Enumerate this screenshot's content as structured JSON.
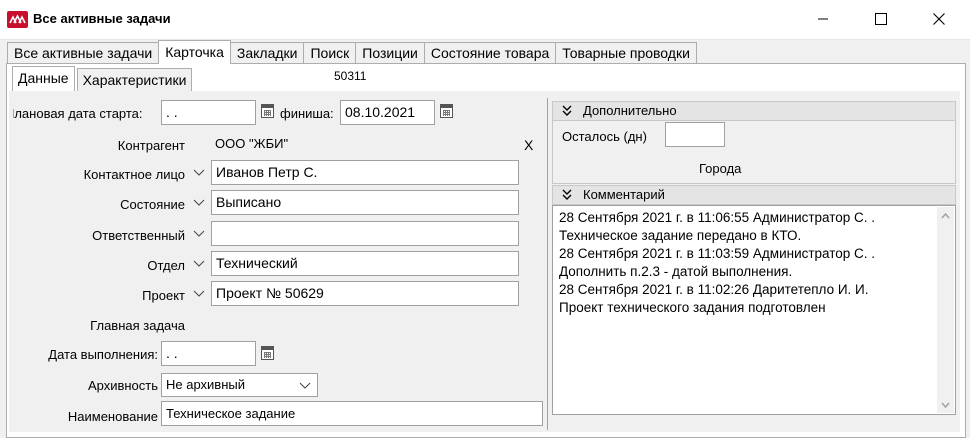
{
  "window": {
    "title": "Все активные задачи",
    "logo_icon": "app-logo-icon",
    "controls": [
      "minimize-icon",
      "maximize-icon",
      "close-icon"
    ]
  },
  "tabs": [
    {
      "label": "Все активные задачи",
      "active": false
    },
    {
      "label": "Карточка",
      "active": true
    },
    {
      "label": "Закладки",
      "active": false
    },
    {
      "label": "Поиск",
      "active": false
    },
    {
      "label": "Позиции",
      "active": false
    },
    {
      "label": "Состояние товара",
      "active": false
    },
    {
      "label": "Товарные проводки",
      "active": false
    }
  ],
  "subtabs": [
    {
      "label": "Данные",
      "active": true
    },
    {
      "label": "Характеристики",
      "active": false
    }
  ],
  "doc_number": "50311",
  "form": {
    "start_label": "Плановая дата старта:",
    "start_value": " .  .",
    "finish_label": "финиша:",
    "finish_value": "08.10.2021",
    "counterparty_label": "Контрагент",
    "counterparty_value": "ООО \"ЖБИ\"",
    "counterparty_clear": "X",
    "contact_label": "Контактное лицо",
    "contact_value": "Иванов Петр С.",
    "state_label": "Состояние",
    "state_value": "Выписано",
    "responsible_label": "Ответственный",
    "responsible_value": "",
    "department_label": "Отдел",
    "department_value": "Технический",
    "project_label": "Проект",
    "project_value": "Проект № 50629",
    "main_task_label": "Главная задача",
    "done_date_label": "Дата выполнения:",
    "done_date_value": " .  .",
    "archive_label": "Архивность",
    "archive_value": "Не архивный",
    "name_label": "Наименование",
    "name_value": "Техническое задание"
  },
  "extra": {
    "header": "Дополнительно",
    "days_left_label": "Осталось (дн)",
    "days_left_value": "",
    "cities_label": "Города"
  },
  "comments": {
    "header": "Комментарий",
    "lines": [
      "28 Сентября 2021 г. в 11:06:55 Администратор С. .",
      "Техническое задание передано в КТО.",
      "28 Сентября 2021 г. в 11:03:59 Администратор С. .",
      "Дополнить п.2.3 - датой выполнения.",
      "28 Сентября 2021 г. в 11:02:26 Даритетепло И. И.",
      "Проект технического задания подготовлен"
    ]
  }
}
